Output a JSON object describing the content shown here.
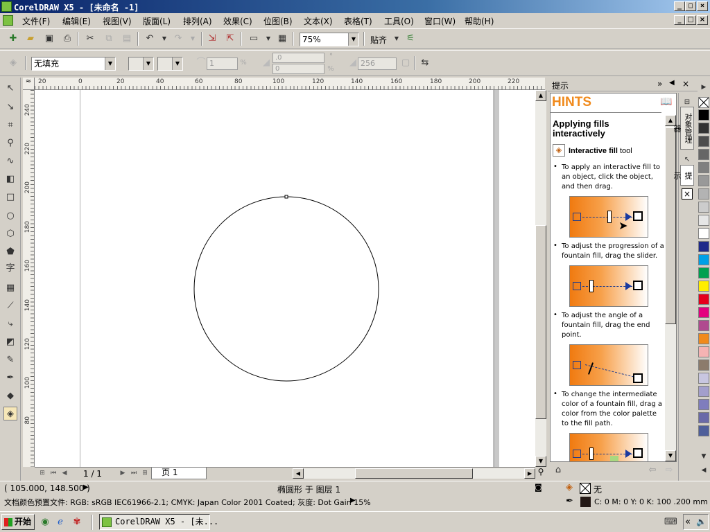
{
  "window": {
    "title": "CorelDRAW X5 - [未命名 -1]"
  },
  "menu": [
    "文件(F)",
    "编辑(E)",
    "视图(V)",
    "版面(L)",
    "排列(A)",
    "效果(C)",
    "位图(B)",
    "文本(X)",
    "表格(T)",
    "工具(O)",
    "窗口(W)",
    "帮助(H)"
  ],
  "standard_toolbar": {
    "zoom": "75%",
    "snap_label": "贴齐"
  },
  "property_bar": {
    "fill": "无填充",
    "step_value": "1",
    "angle1": ".0",
    "angle2": "0",
    "steps_256": "256",
    "degree_symbol": "°"
  },
  "rulers": {
    "units_symbol": "≈",
    "horizontal": [
      "20",
      "0",
      "20",
      "40",
      "60",
      "80",
      "100",
      "120",
      "140",
      "160",
      "180",
      "200",
      "220"
    ],
    "vertical": [
      "240",
      "220",
      "200",
      "180",
      "160",
      "140",
      "120",
      "100",
      "80"
    ]
  },
  "page_nav": {
    "count": "1 / 1",
    "page_tab": "页 1"
  },
  "docker": {
    "title": "提示",
    "hints_header": "HINTS",
    "heading": "Applying fills interactively",
    "tool_bold": "Interactive fill",
    "tool_rest": " tool",
    "bullets": [
      "To apply an interactive fill to an object, click the object, and then drag.",
      "To adjust the progression of a fountain fill, drag the slider.",
      "To adjust the angle of a fountain fill, drag the end point.",
      "To change the intermediate color of a fountain fill, drag a color from the color palette to the fill path."
    ],
    "side_tabs": [
      "对象管理器",
      "提示"
    ]
  },
  "palette": {
    "colors": [
      "#000000",
      "#333333",
      "#4d4d4d",
      "#666666",
      "#808080",
      "#999999",
      "#b3b3b3",
      "#cccccc",
      "#e6e6e6",
      "#ffffff",
      "#1f2a8a",
      "#00a0e6",
      "#00a050",
      "#ffee00",
      "#e5001c",
      "#e4007f",
      "#b04a8f",
      "#f08a1c",
      "#f5b3b3",
      "#8c7b6b",
      "#c8c6e0",
      "#a39fcc",
      "#7f7dbd",
      "#6a6aa8",
      "#4f5f9a"
    ]
  },
  "status": {
    "coords": "( 105.000, 148.500 )",
    "object_info": "椭圆形 于 图层 1",
    "color_profile": "文档颜色预置文件: RGB: sRGB IEC61966-2.1; CMYK: Japan Color 2001 Coated; 灰度: Dot Gain 15%",
    "fill_none": "无",
    "outline_info": "C: 0 M: 0 Y: 0 K: 100  .200 mm"
  },
  "taskbar": {
    "start": "开始",
    "task": "CorelDRAW X5 - [未..."
  }
}
